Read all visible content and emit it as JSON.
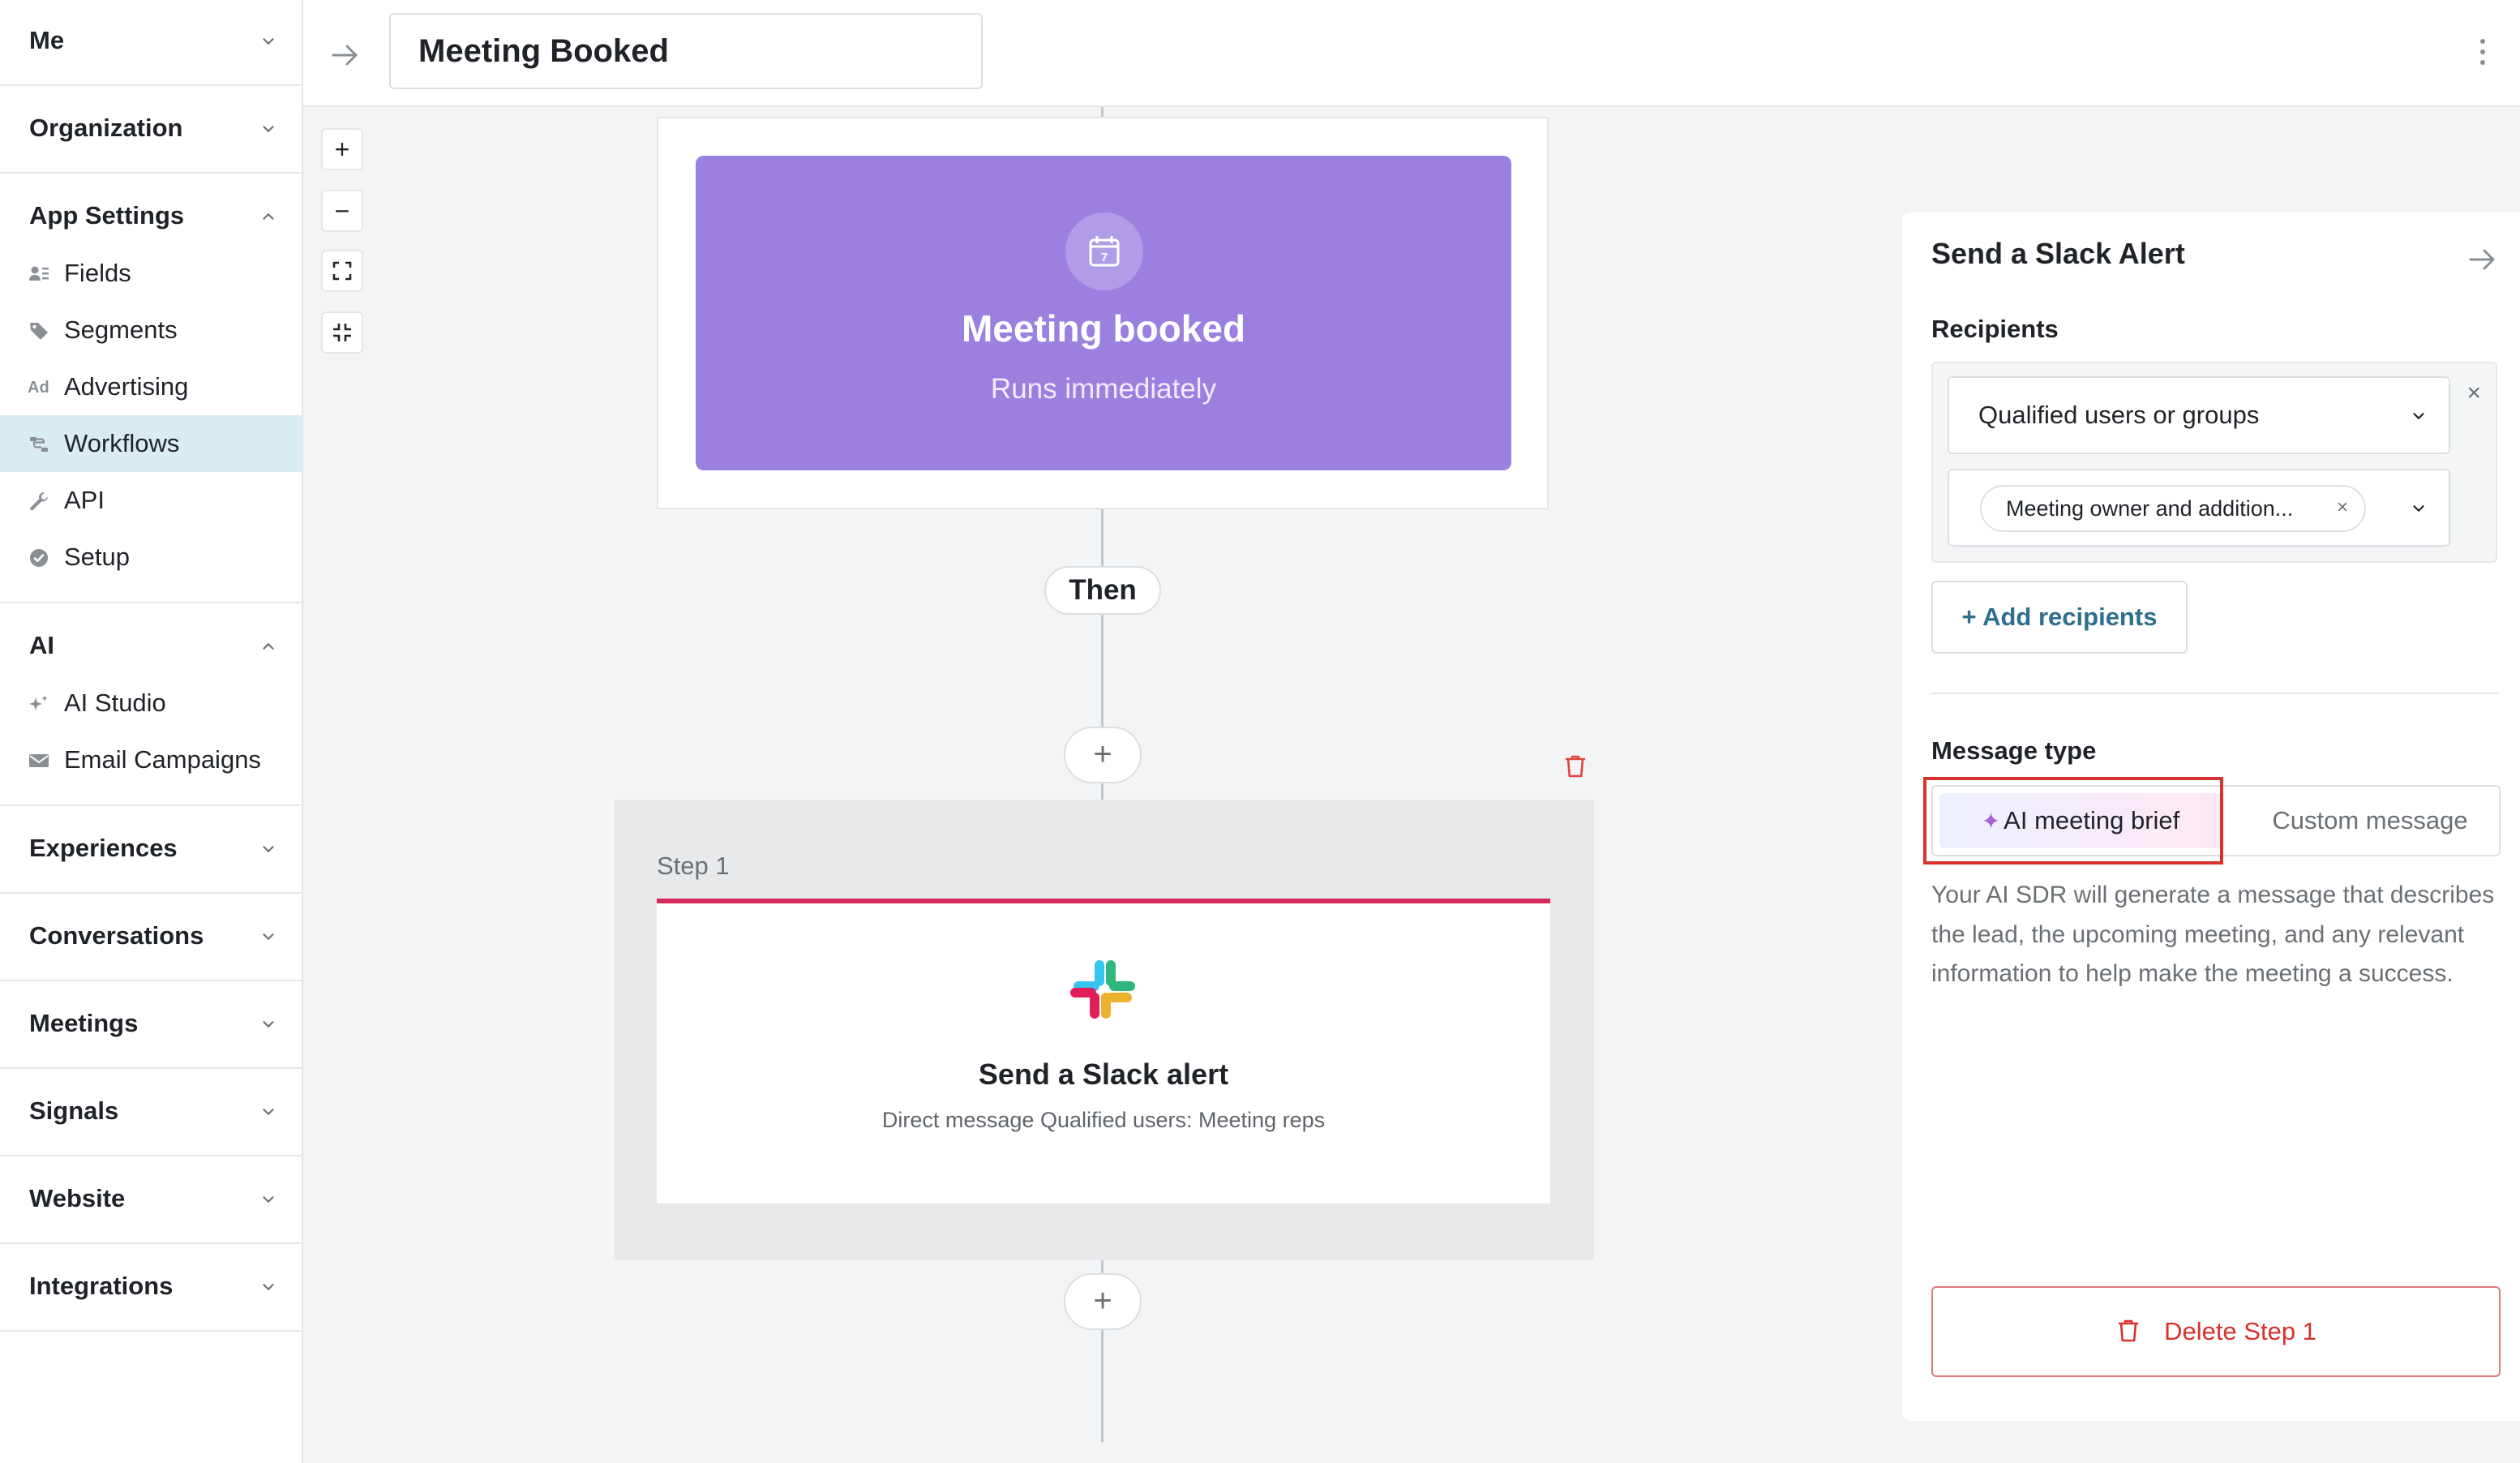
{
  "sidebar": {
    "me": "Me",
    "organization": "Organization",
    "app_settings": {
      "title": "App Settings",
      "items": [
        {
          "label": "Fields",
          "icon": "user-fields-icon"
        },
        {
          "label": "Segments",
          "icon": "tag-icon"
        },
        {
          "label": "Advertising",
          "icon": "ad-icon",
          "glyph": "Ad"
        },
        {
          "label": "Workflows",
          "icon": "workflow-icon",
          "active": true
        },
        {
          "label": "API",
          "icon": "wrench-icon"
        },
        {
          "label": "Setup",
          "icon": "check-circle-icon"
        }
      ]
    },
    "ai": {
      "title": "AI",
      "items": [
        {
          "label": "AI Studio",
          "icon": "sparkle-icon"
        },
        {
          "label": "Email Campaigns",
          "icon": "envelope-icon"
        }
      ]
    },
    "experiences": "Experiences",
    "conversations": "Conversations",
    "meetings": "Meetings",
    "signals": "Signals",
    "website": "Website",
    "integrations": "Integrations"
  },
  "header": {
    "workflow_name": "Meeting Booked"
  },
  "canvas": {
    "zoom_in": "+",
    "zoom_out": "−",
    "trigger": {
      "title": "Meeting booked",
      "subtitle": "Runs immediately",
      "calendar_day": "7"
    },
    "then_label": "Then",
    "add_label": "+",
    "step": {
      "label": "Step 1",
      "title": "Send a Slack alert",
      "description": "Direct message Qualified users: Meeting reps"
    }
  },
  "panel": {
    "title": "Send a Slack Alert",
    "recipients_label": "Recipients",
    "recipient_type": "Qualified users or groups",
    "recipient_chip": "Meeting owner and addition...",
    "chip_remove": "×",
    "remove_recipient": "×",
    "add_recipients": "+ Add recipients",
    "message_type_label": "Message type",
    "message_types": {
      "ai": "AI meeting brief",
      "custom": "Custom message"
    },
    "ai_sparkle": "✦",
    "description": "Your AI SDR will generate a message that describes the lead, the upcoming meeting, and any relevant information to help make the meeting a success.",
    "delete_button": "Delete Step 1"
  },
  "colors": {
    "trigger_bg": "#9b80e0",
    "step_accent": "#d72a5c",
    "active_nav_bg": "#dbecf0",
    "danger": "#d9312c",
    "link": "#2f6e8e"
  }
}
